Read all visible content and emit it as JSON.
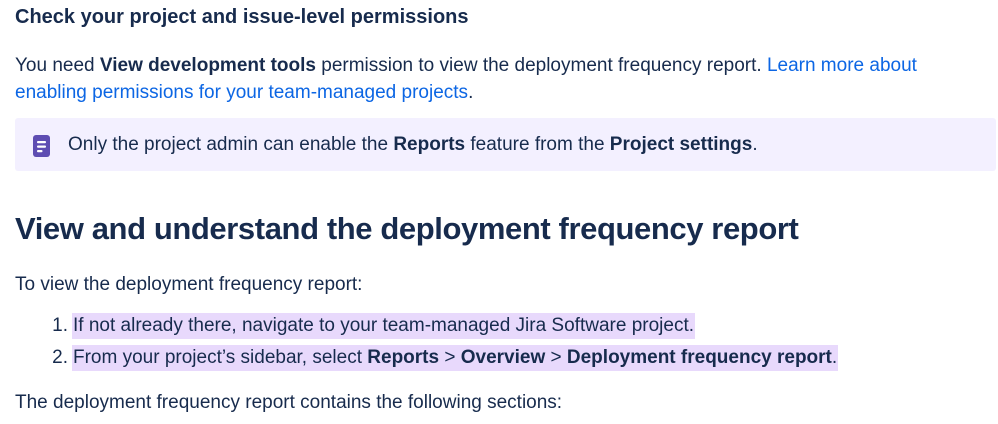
{
  "permissions_section": {
    "heading": "Check your project and issue-level permissions",
    "text_1": "You need ",
    "bold_permission": "View development tools",
    "text_2": " permission to view the deployment frequency report. ",
    "link": "Learn more about enabling permissions for your team-managed projects",
    "text_3": "."
  },
  "note": {
    "icon": "note-icon",
    "text_1": "Only the project admin can enable the ",
    "bold_1": "Reports",
    "text_2": " feature from the ",
    "bold_2": "Project settings",
    "text_3": ".",
    "colors": {
      "background": "#f3f0ff",
      "icon": "#5e4db2"
    }
  },
  "report_section": {
    "heading": "View and understand the deployment frequency report",
    "intro": "To view the deployment frequency report:",
    "steps": [
      {
        "number": "1.",
        "text": "If not already there, navigate to your team-managed Jira Software project."
      },
      {
        "number": "2.",
        "text_1": "From your project’s sidebar, select ",
        "bold_1": "Reports",
        "sep_1": " > ",
        "bold_2": "Overview",
        "sep_2": " > ",
        "bold_3": "Deployment frequency report",
        "text_2": "."
      }
    ],
    "outro": "The deployment frequency report contains the following sections:",
    "highlight_color": "#e8d9fc"
  },
  "colors": {
    "text": "#172b4d",
    "link": "#0c66e4"
  }
}
